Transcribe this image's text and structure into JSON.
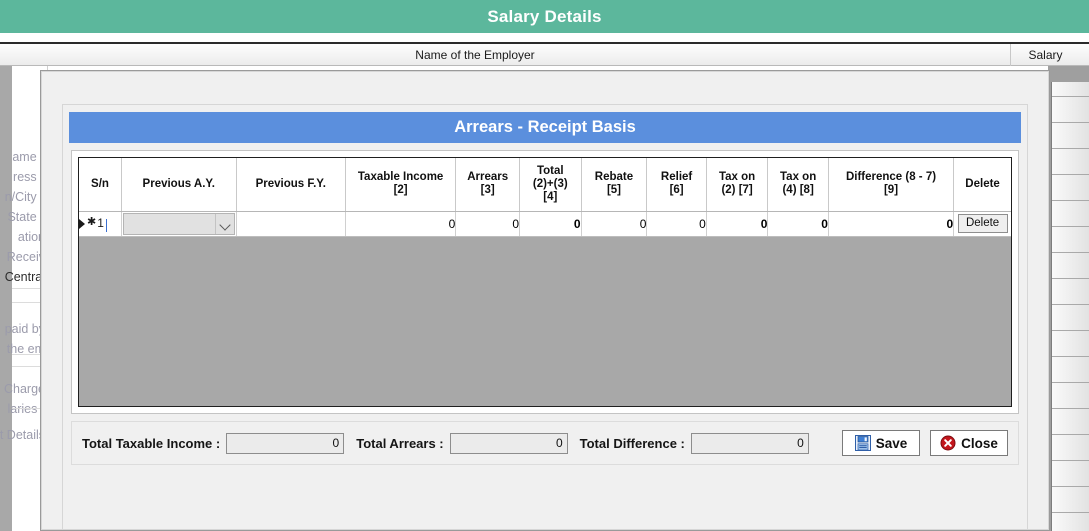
{
  "background": {
    "page_title": "Salary Details",
    "column_headers": {
      "employer": "Name of the Employer",
      "salary": "Salary"
    },
    "left_labels": [
      "ame *",
      "ress *",
      "n/City *",
      "State *",
      "ation",
      "Receiv",
      "Central",
      "paid by",
      "the em",
      "Charge",
      "laries (",
      "t Details"
    ]
  },
  "dialog": {
    "title": "Arrears - Receipt Basis",
    "grid": {
      "columns": [
        {
          "header": "S/n",
          "key": "sn"
        },
        {
          "header": "Previous A.Y.",
          "key": "prev_ay"
        },
        {
          "header": "Previous F.Y.",
          "key": "prev_fy"
        },
        {
          "header": "Taxable Income [2]",
          "key": "taxable_income"
        },
        {
          "header": "Arrears [3]",
          "key": "arrears"
        },
        {
          "header": "Total (2)+(3) [4]",
          "key": "total"
        },
        {
          "header": "Rebate [5]",
          "key": "rebate"
        },
        {
          "header": "Relief [6]",
          "key": "relief"
        },
        {
          "header": "Tax on (2) [7]",
          "key": "tax_on_2"
        },
        {
          "header": "Tax on (4) [8]",
          "key": "tax_on_4"
        },
        {
          "header": "Difference (8 - 7) [9]",
          "key": "difference"
        },
        {
          "header": "Delete",
          "key": "delete"
        }
      ],
      "header_lines": {
        "sn": [
          "S/n"
        ],
        "prev_ay": [
          "Previous A.Y."
        ],
        "prev_fy": [
          "Previous F.Y."
        ],
        "taxable_income": [
          "Taxable Income",
          "[2]"
        ],
        "arrears": [
          "Arrears",
          "[3]"
        ],
        "total": [
          "Total",
          "(2)+(3)",
          "[4]"
        ],
        "rebate": [
          "Rebate",
          "[5]"
        ],
        "relief": [
          "Relief",
          "[6]"
        ],
        "tax_on_2": [
          "Tax on",
          "(2) [7]"
        ],
        "tax_on_4": [
          "Tax on",
          "(4) [8]"
        ],
        "difference": [
          "Difference (8 - 7)",
          "[9]"
        ],
        "delete": [
          "Delete"
        ]
      },
      "row": {
        "sn": "1",
        "prev_ay": "",
        "prev_fy": "",
        "taxable_income": "0",
        "arrears": "0",
        "total": "0",
        "rebate": "0",
        "relief": "0",
        "tax_on_2": "0",
        "tax_on_4": "0",
        "difference": "0",
        "delete_label": "Delete"
      }
    },
    "footer": {
      "total_taxable_income_label": "Total Taxable Income :",
      "total_taxable_income_value": "0",
      "total_arrears_label": "Total Arrears :",
      "total_arrears_value": "0",
      "total_difference_label": "Total Difference :",
      "total_difference_value": "0",
      "save_label": "Save",
      "close_label": "Close"
    }
  },
  "colors": {
    "page_header": "#5cb79c",
    "dialog_header": "#5b8fdd",
    "grid_empty": "#a8a8a8",
    "readonly_cell": "#e2e2e2"
  }
}
